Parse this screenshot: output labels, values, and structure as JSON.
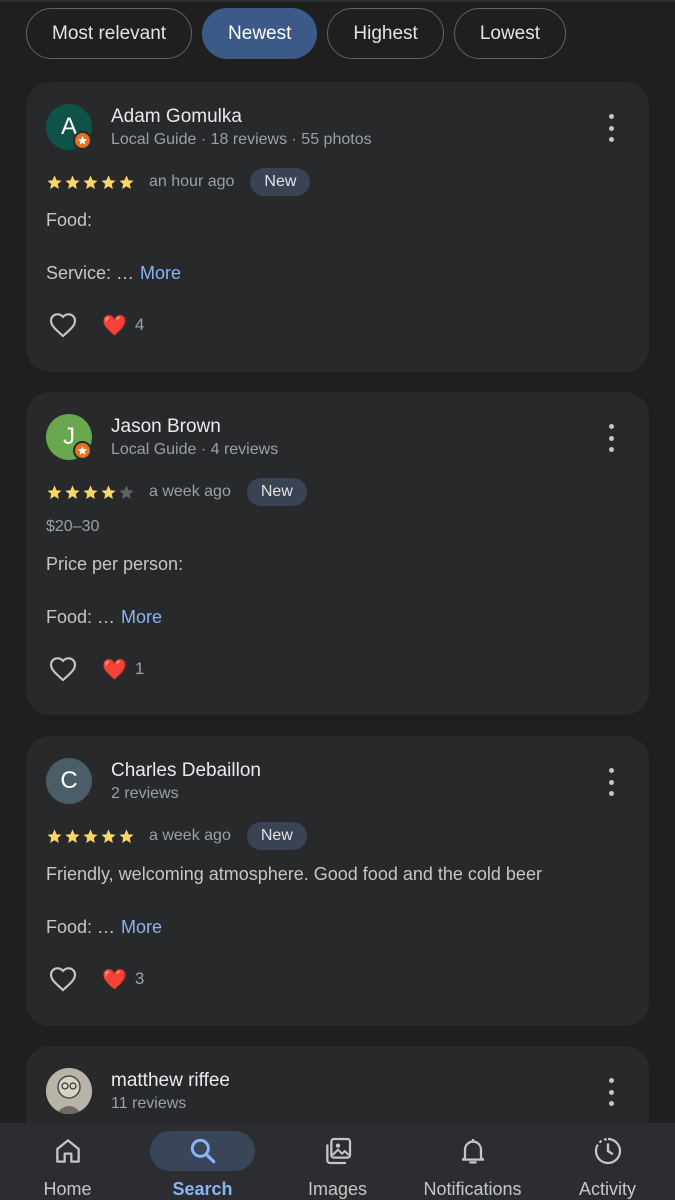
{
  "filters": {
    "chips": [
      "Most relevant",
      "Newest",
      "Highest",
      "Lowest"
    ],
    "active": "Newest"
  },
  "reviews": [
    {
      "initial": "A",
      "avatar_color": "#0f5249",
      "local_guide": true,
      "name": "Adam Gomulka",
      "meta": "Local Guide · 18 reviews · 55 photos",
      "rating": 5,
      "time": "an hour ago",
      "badge": "New",
      "lines": [
        "Food:",
        "Service: …"
      ],
      "more_label": "More",
      "reaction": "❤️",
      "reaction_count": "4"
    },
    {
      "initial": "J",
      "avatar_color": "#6aa84f",
      "local_guide": true,
      "name": "Jason Brown",
      "meta": "Local Guide · 4 reviews",
      "rating": 4,
      "time": "a week ago",
      "badge": "New",
      "price": "$20–30",
      "lines": [
        "Price per person:",
        "Food: …"
      ],
      "more_label": "More",
      "reaction": "❤️",
      "reaction_count": "1"
    },
    {
      "initial": "C",
      "avatar_color": "#4b5d69",
      "local_guide": false,
      "name": "Charles Debaillon",
      "meta": "2 reviews",
      "rating": 5,
      "time": "a week ago",
      "badge": "New",
      "lines": [
        "Friendly, welcoming atmosphere. Good food and the cold beer",
        "Food: …"
      ],
      "more_label": "More",
      "reaction": "❤️",
      "reaction_count": "3"
    },
    {
      "name": "matthew riffee",
      "meta": "11 reviews",
      "avatar_type": "photo"
    }
  ],
  "nav": {
    "items": [
      {
        "label": "Home",
        "icon": "home-icon"
      },
      {
        "label": "Search",
        "icon": "search-icon"
      },
      {
        "label": "Images",
        "icon": "images-icon"
      },
      {
        "label": "Notifications",
        "icon": "bell-icon"
      },
      {
        "label": "Activity",
        "icon": "activity-icon"
      }
    ],
    "active": "Search"
  },
  "colors": {
    "background": "#1f1f1f",
    "card": "#28292b",
    "accent": "#8ab4f8",
    "active_chip": "#3b5a87",
    "star": "#fdd663",
    "star_empty": "#5f6368"
  }
}
